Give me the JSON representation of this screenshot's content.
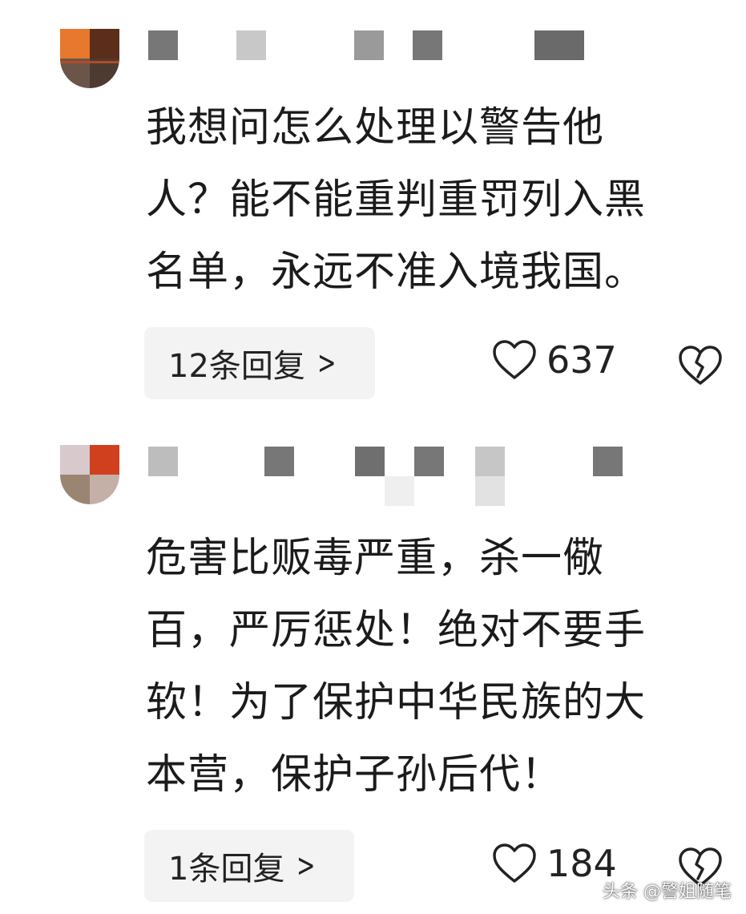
{
  "comments": [
    {
      "text": "我想问怎么处理以警告他\n人？能不能重判重罚列入黑\n名单，永远不准入境我国。",
      "reply_label": "12条回复",
      "like_count": "637"
    },
    {
      "text": "危害比贩毒严重，杀一儆\n百，严厉惩处！绝对不要手\n软！为了保护中华民族的大\n本营，保护子孙后代！",
      "reply_label": "1条回复",
      "like_count": "184"
    }
  ],
  "icons": {
    "like": "heart-outline-icon",
    "dislike": "broken-heart-icon",
    "reply_chevron": "chevron-right-icon"
  },
  "watermark": "头条 @警姐随笔"
}
